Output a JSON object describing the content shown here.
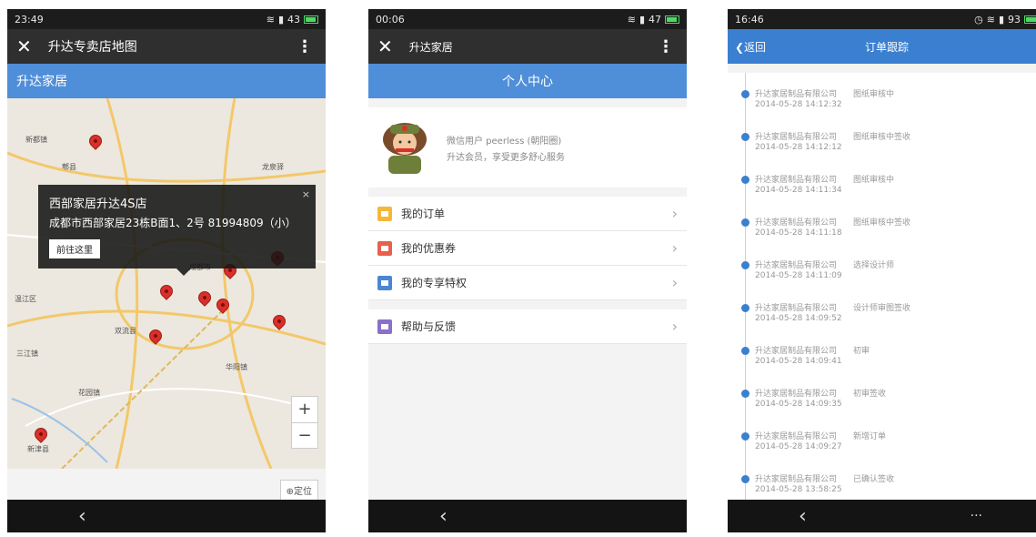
{
  "colors": {
    "accent": "#4f8ed8",
    "pin": "#d9302a",
    "nav_dark": "#2f2f2f"
  },
  "screen1": {
    "status": {
      "time": "23:49",
      "battery": "43"
    },
    "nav": {
      "close_icon": "close-icon",
      "title": "升达专卖店地图",
      "menu_icon": "more-vertical-icon"
    },
    "brand": "升达家居",
    "popup": {
      "name": "西部家居升达4S店",
      "address": "成都市西部家居23栋B面1、2号 81994809（小）",
      "button": "前往这里",
      "close": "×"
    },
    "map_labels": [
      "新都镇",
      "双流县",
      "温江区",
      "成都市",
      "郫县",
      "龙泉驿",
      "华阳镇",
      "新津县",
      "三江镇",
      "花园镇"
    ],
    "zoom": {
      "in": "+",
      "out": "−"
    },
    "locate": "⊕定位",
    "bottom_back": "‹"
  },
  "screen2": {
    "status": {
      "time": "00:06",
      "battery": "47"
    },
    "nav": {
      "title": "升达家居"
    },
    "header": "个人中心",
    "profile": {
      "user_line": "微信用户 peerless (朝阳圈)",
      "tagline": "升达会员，享受更多舒心服务"
    },
    "menu": [
      {
        "label": "我的订单",
        "color": "#f5b73b"
      },
      {
        "label": "我的优惠券",
        "color": "#e8604c"
      },
      {
        "label": "我的专享特权",
        "color": "#4a86d3"
      },
      {
        "label": "帮助与反馈",
        "color": "#8b6fc9"
      }
    ],
    "chevron": "›",
    "bottom_back": "‹"
  },
  "screen3": {
    "status": {
      "time": "16:46",
      "battery": "93"
    },
    "back": "❮返回",
    "title": "订单跟踪",
    "events": [
      {
        "company": "升达家居制品有限公司",
        "time": "2014-05-28 14:12:32",
        "status": "图纸审核中"
      },
      {
        "company": "升达家居制品有限公司",
        "time": "2014-05-28 14:12:12",
        "status": "图纸审核中签收"
      },
      {
        "company": "升达家居制品有限公司",
        "time": "2014-05-28 14:11:34",
        "status": "图纸审核中"
      },
      {
        "company": "升达家居制品有限公司",
        "time": "2014-05-28 14:11:18",
        "status": "图纸审核中签收"
      },
      {
        "company": "升达家居制品有限公司",
        "time": "2014-05-28 14:11:09",
        "status": "选择设计师"
      },
      {
        "company": "升达家居制品有限公司",
        "time": "2014-05-28 14:09:52",
        "status": "设计师审图签收"
      },
      {
        "company": "升达家居制品有限公司",
        "time": "2014-05-28 14:09:41",
        "status": "初审"
      },
      {
        "company": "升达家居制品有限公司",
        "time": "2014-05-28 14:09:35",
        "status": "初审签收"
      },
      {
        "company": "升达家居制品有限公司",
        "time": "2014-05-28 14:09:27",
        "status": "新增订单"
      },
      {
        "company": "升达家居制品有限公司",
        "time": "2014-05-28 13:58:25",
        "status": "已确认签收"
      }
    ],
    "bottom_back": "‹",
    "bottom_more": "···"
  }
}
